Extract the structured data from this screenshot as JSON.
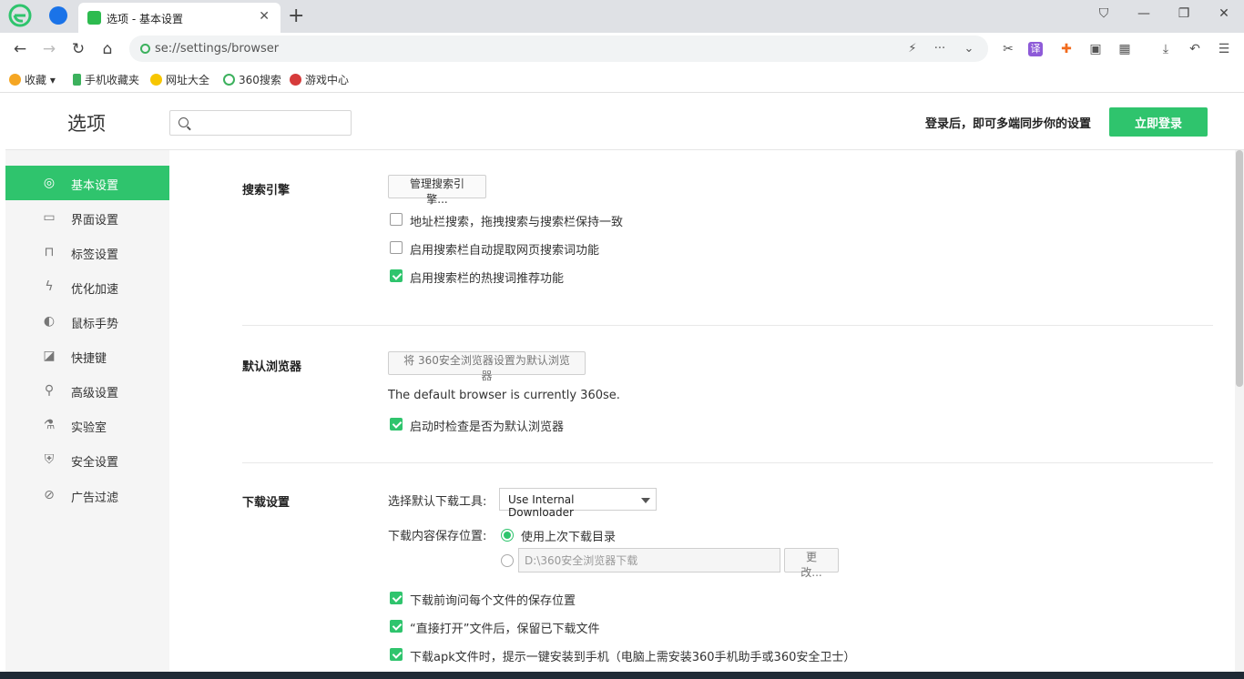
{
  "tab": {
    "title": "选项 - 基本设置",
    "close": "✕"
  },
  "newtab": "+",
  "window": {
    "menu": "⛉",
    "min": "—",
    "restore": "❐",
    "close": "✕"
  },
  "nav": {
    "back": "←",
    "forward": "→",
    "reload": "↻",
    "home": "⌂"
  },
  "address": {
    "url": "se://settings/browser"
  },
  "address_actions": {
    "flash": "⚡",
    "more": "···",
    "dropdown": "⌄"
  },
  "extensions": {
    "cut": "✂",
    "translate": "译",
    "game": "✚",
    "reader": "▣",
    "apps": "▦",
    "download": "⤓",
    "undo": "↶",
    "menu": "☰"
  },
  "bookmarks": [
    {
      "label": "收藏 ▾",
      "icon": "star-icon",
      "color": "#f5a623"
    },
    {
      "label": "手机收藏夹",
      "icon": "phone-icon",
      "color": "#3cb15d"
    },
    {
      "label": "网址大全",
      "icon": "globe-icon",
      "color": "#f7c600"
    },
    {
      "label": "360搜索",
      "icon": "search360-icon",
      "color": "#3cb15d"
    },
    {
      "label": "游戏中心",
      "icon": "game-icon",
      "color": "#d63b3b"
    }
  ],
  "header": {
    "title": "选项",
    "search_placeholder": "",
    "sync_text": "登录后，即可多端同步你的设置",
    "login_label": "立即登录"
  },
  "sidebar": {
    "items": [
      {
        "label": "基本设置",
        "icon": "◎",
        "active": true
      },
      {
        "label": "界面设置",
        "icon": "▭"
      },
      {
        "label": "标签设置",
        "icon": "⊓"
      },
      {
        "label": "优化加速",
        "icon": "ϟ"
      },
      {
        "label": "鼠标手势",
        "icon": "◐"
      },
      {
        "label": "快捷键",
        "icon": "◪"
      },
      {
        "label": "高级设置",
        "icon": "⚲"
      },
      {
        "label": "实验室",
        "icon": "⚗"
      },
      {
        "label": "安全设置",
        "icon": "⛨"
      },
      {
        "label": "广告过滤",
        "icon": "⊘"
      }
    ]
  },
  "search_engine": {
    "title": "搜索引擎",
    "manage_label": "管理搜索引擎...",
    "options": [
      {
        "label": "地址栏搜索，拖拽搜索与搜索栏保持一致",
        "checked": false
      },
      {
        "label": "启用搜索栏自动提取网页搜索词功能",
        "checked": false
      },
      {
        "label": "启用搜索栏的热搜词推荐功能",
        "checked": true
      }
    ]
  },
  "default_browser": {
    "title": "默认浏览器",
    "set_label": "将 360安全浏览器设置为默认浏览器",
    "status": "The default browser is currently 360se.",
    "check_label": "启动时检查是否为默认浏览器",
    "check_checked": true
  },
  "download": {
    "title": "下载设置",
    "tool_label": "选择默认下载工具:",
    "tool_value": "Use Internal Downloader",
    "location_label": "下载内容保存位置:",
    "radio_last": "使用上次下载目录",
    "path_value": "D:\\360安全浏览器下载",
    "change_label": "更改...",
    "options": [
      {
        "label": "下载前询问每个文件的保存位置",
        "checked": true
      },
      {
        "label": "“直接打开”文件后，保留已下载文件",
        "checked": true
      },
      {
        "label": "下载apk文件时，提示一键安装到手机（电脑上需安装360手机助手或360安全卫士）",
        "checked": true
      }
    ]
  },
  "colors": {
    "accent": "#2fc46d",
    "sidebar_bg": "#f5f5f5"
  }
}
